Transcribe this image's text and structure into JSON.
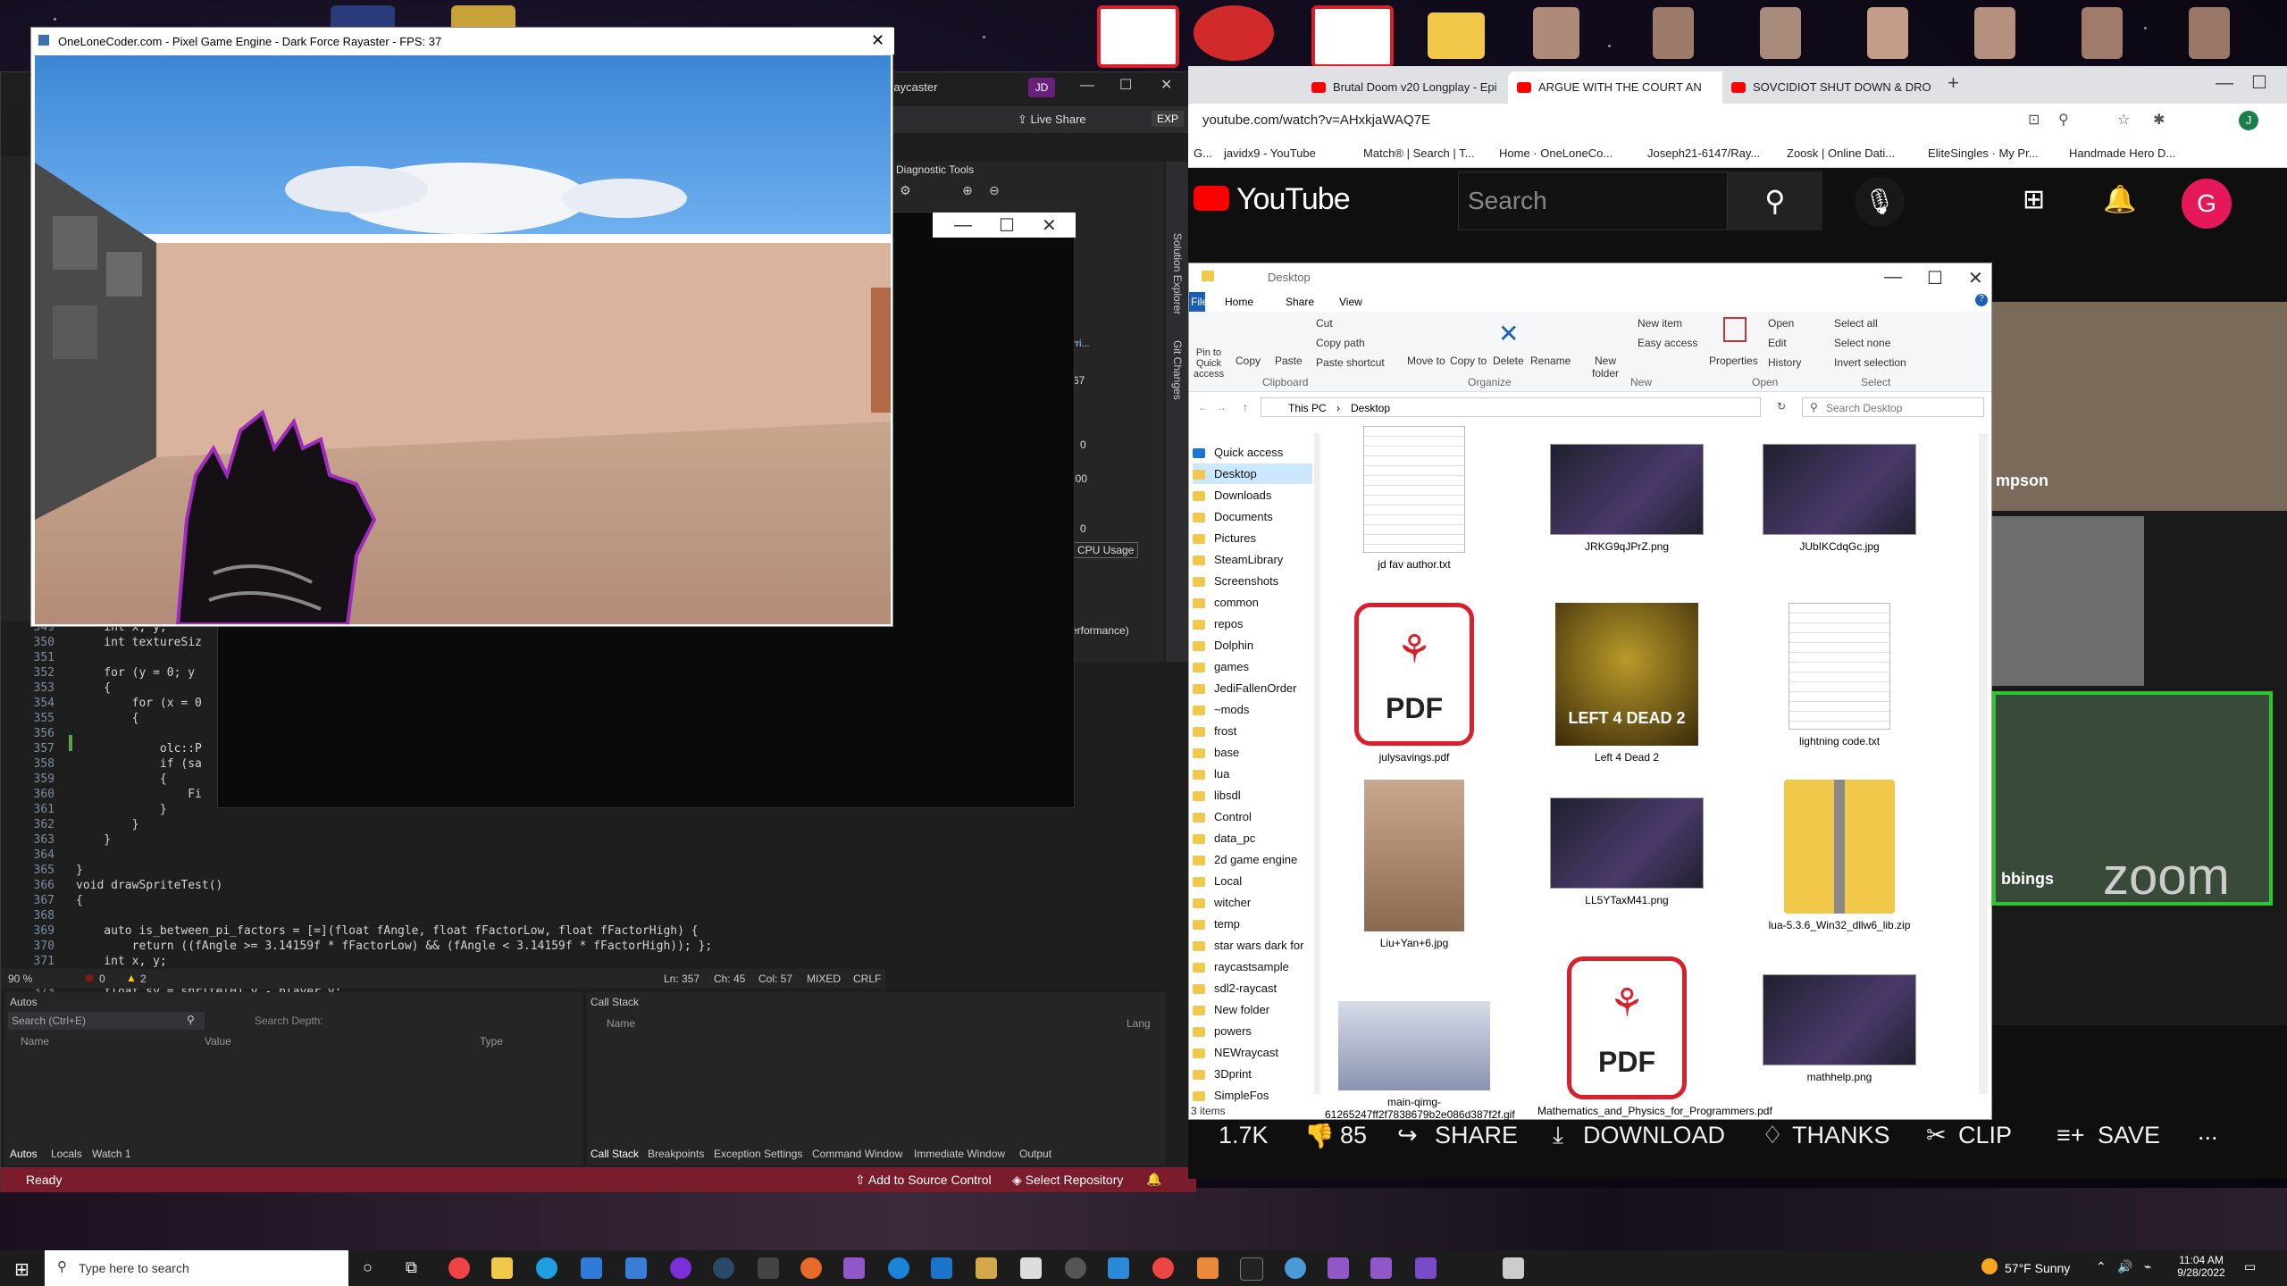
{
  "game": {
    "title": "OneLoneCoder.com - Pixel Game Engine - Dark Force Rayaster - FPS: 37"
  },
  "vs": {
    "project_title": "raycaster",
    "user_initials": "JD",
    "live_share": "Live Share",
    "exp_badge": "EXP",
    "diag_title": "Diagnostic Tools",
    "diag_values": [
      "67",
      "0",
      "100",
      "0"
    ],
    "cpu_usage": "CPU Usage",
    "performance": "erformance)",
    "pri": "Pri...",
    "side_tabs": [
      "Solution Explorer",
      "Git Changes"
    ],
    "code_lines": [
      {
        "n": "349",
        "t": "    int x, y;"
      },
      {
        "n": "350",
        "t": "    int textureSiz"
      },
      {
        "n": "351",
        "t": ""
      },
      {
        "n": "352",
        "t": "    for (y = 0; y"
      },
      {
        "n": "353",
        "t": "    {"
      },
      {
        "n": "354",
        "t": "        for (x = 0"
      },
      {
        "n": "355",
        "t": "        {"
      },
      {
        "n": "356",
        "t": ""
      },
      {
        "n": "357",
        "t": "            olc::P"
      },
      {
        "n": "358",
        "t": "            if (sa"
      },
      {
        "n": "359",
        "t": "            {"
      },
      {
        "n": "360",
        "t": "                Fi"
      },
      {
        "n": "361",
        "t": "            }"
      },
      {
        "n": "362",
        "t": "        }"
      },
      {
        "n": "363",
        "t": "    }"
      },
      {
        "n": "364",
        "t": ""
      },
      {
        "n": "365",
        "t": "}"
      },
      {
        "n": "366",
        "t": "void drawSpriteTest()"
      },
      {
        "n": "367",
        "t": "{"
      },
      {
        "n": "368",
        "t": ""
      },
      {
        "n": "369",
        "t": "    auto is_between_pi_factors = [=](float fAngle, float fFactorLow, float fFactorHigh) {"
      },
      {
        "n": "370",
        "t": "        return ((fAngle >= 3.14159f * fFactorLow) && (fAngle < 3.14159f * fFactorHigh)); };"
      },
      {
        "n": "371",
        "t": "    int x, y;"
      },
      {
        "n": "372",
        "t": "    float sx = sprite[0].x - player.x;"
      },
      {
        "n": "373",
        "t": "    float sy = sprite[0].y - player.y;"
      }
    ],
    "editor_status": {
      "zoom": "90 %",
      "errors": "0",
      "warnings": "2",
      "ln": "Ln: 357",
      "ch": "Ch: 45",
      "col": "Col: 57",
      "mixed": "MIXED",
      "crlf": "CRLF"
    },
    "autos": {
      "title": "Autos",
      "search_placeholder": "Search (Ctrl+E)",
      "search_depth": "Search Depth:",
      "columns": [
        "Name",
        "Value",
        "Type"
      ],
      "tabs": [
        "Autos",
        "Locals",
        "Watch 1"
      ]
    },
    "callstack": {
      "title": "Call Stack",
      "columns": [
        "Name",
        "Lang"
      ],
      "tabs": [
        "Call Stack",
        "Breakpoints",
        "Exception Settings",
        "Command Window",
        "Immediate Window",
        "Output"
      ]
    },
    "status": {
      "ready": "Ready",
      "source_control": "Add to Source Control",
      "repo": "Select Repository"
    }
  },
  "chrome": {
    "tabs": [
      {
        "label": "Brutal Doom v20 Longplay - Epi"
      },
      {
        "label": "ARGUE WITH THE COURT AN"
      },
      {
        "label": "SOVCIDIOT SHUT DOWN & DRO"
      }
    ],
    "url": "youtube.com/watch?v=AHxkjaWAQ7E",
    "profile_initial": "J",
    "bookmarks": [
      "G...",
      "javidx9 - YouTube",
      "Match® | Search | T...",
      "Home · OneLoneCo...",
      "Joseph21-6147/Ray...",
      "Zoosk | Online Dati...",
      "EliteSingles · My Pr...",
      "Handmade Hero D..."
    ]
  },
  "youtube": {
    "logo": "YouTube",
    "search_placeholder": "Search",
    "avatar": "G",
    "likes": "1.7K",
    "dislikes": "85",
    "actions": [
      "SHARE",
      "DOWNLOAD",
      "THANKS",
      "CLIP",
      "SAVE"
    ],
    "more": "...",
    "zoom_names": [
      "mpson",
      "bbings"
    ],
    "zoom_logo": "zoom"
  },
  "explorer": {
    "title": "Desktop",
    "ribbon_tabs": [
      "File",
      "Home",
      "Share",
      "View"
    ],
    "clipboard": [
      "Pin to Quick access",
      "Copy",
      "Paste",
      "Cut",
      "Copy path",
      "Paste shortcut"
    ],
    "organize": [
      "Move to",
      "Copy to",
      "Delete",
      "Rename"
    ],
    "new": [
      "New folder",
      "New item",
      "Easy access"
    ],
    "open": [
      "Properties",
      "Open",
      "Edit",
      "History"
    ],
    "select": [
      "Select all",
      "Select none",
      "Invert selection"
    ],
    "groups": [
      "Clipboard",
      "Organize",
      "New",
      "Open",
      "Select"
    ],
    "breadcrumb": [
      "This PC",
      "Desktop"
    ],
    "search_placeholder": "Search Desktop",
    "nav": [
      "Quick access",
      "Desktop",
      "Downloads",
      "Documents",
      "Pictures",
      "SteamLibrary",
      "Screenshots",
      "common",
      "repos",
      "Dolphin",
      "games",
      "JediFallenOrder",
      "~mods",
      "frost",
      "base",
      "lua",
      "libsdl",
      "Control",
      "data_pc",
      "2d game engine",
      "Local",
      "witcher",
      "temp",
      "star wars dark for",
      "raycastsample",
      "sdl2-raycast",
      "New folder",
      "powers",
      "NEWraycast",
      "3Dprint",
      "SimpleFos"
    ],
    "files": [
      {
        "name": "jd fav author.txt",
        "kind": "txt"
      },
      {
        "name": "JRKG9qJPrZ.png",
        "kind": "png"
      },
      {
        "name": "JUbIKCdqGc.jpg",
        "kind": "png"
      },
      {
        "name": "julysavings.pdf",
        "kind": "pdf"
      },
      {
        "name": "Left 4 Dead 2",
        "kind": "game"
      },
      {
        "name": "lightning code.txt",
        "kind": "txt"
      },
      {
        "name": "Liu+Yan+6.jpg",
        "kind": "photo"
      },
      {
        "name": "LL5YTaxM41.png",
        "kind": "png"
      },
      {
        "name": "lua-5.3.6_Win32_dllw6_lib.zip",
        "kind": "zip"
      },
      {
        "name": "main-qimg-61265247ff2f7838679b2e086d387f2f.gif",
        "kind": "gif"
      },
      {
        "name": "Mathematics_and_Physics_for_Programmers.pdf",
        "kind": "pdf"
      },
      {
        "name": "mathhelp.png",
        "kind": "png"
      }
    ],
    "pdf_label": "PDF",
    "game_label": "LEFT 4 DEAD 2",
    "status": "3 items"
  },
  "taskbar": {
    "search_placeholder": "Type here to search",
    "weather": "57°F  Sunny",
    "time": "11:04 AM",
    "date": "9/28/2022"
  }
}
